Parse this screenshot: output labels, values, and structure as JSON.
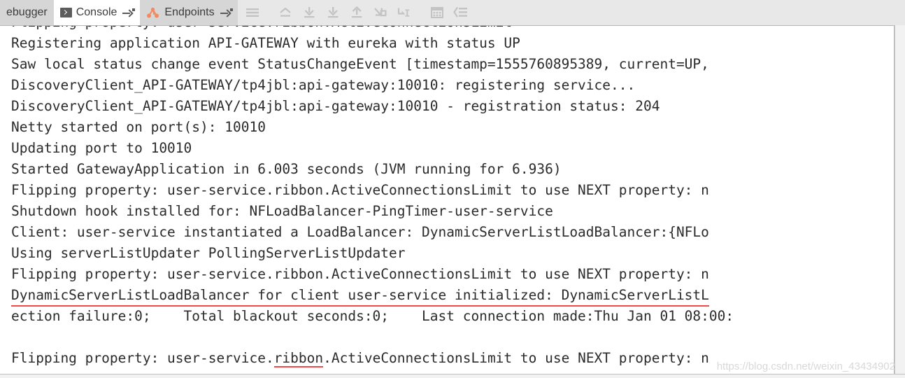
{
  "window": {
    "app": "IntelliJ IDEA Run/Debug Console"
  },
  "toolbar": {
    "tabs": [
      {
        "label": "ebugger",
        "icon": "",
        "state": "inactive",
        "truncated": true
      },
      {
        "label": "Console",
        "icon": "console-icon",
        "state": "active",
        "truncated": false
      },
      {
        "label": "Endpoints",
        "icon": "endpoints-graph-icon",
        "state": "inactive",
        "truncated": false
      }
    ],
    "buttons": [
      {
        "name": "menu-hamburger-icon",
        "title": "Menu"
      },
      {
        "name": "rerun-arrow-icon",
        "title": "Rerun"
      },
      {
        "name": "scroll-down-icon",
        "title": "Scroll to end"
      },
      {
        "name": "download-icon",
        "title": "Step down"
      },
      {
        "name": "upload-icon",
        "title": "Step up"
      },
      {
        "name": "jump-out-icon",
        "title": "Jump out"
      },
      {
        "name": "jump-to-cursor-icon",
        "title": "Run to cursor"
      },
      {
        "name": "grid-table-icon",
        "title": "Show as table"
      },
      {
        "name": "soft-wrap-icon",
        "title": "Soft-wrap"
      }
    ],
    "separators": 3
  },
  "console": {
    "font": "monospace",
    "text_color": "#2b2b2b",
    "underline_color": "#f04a4a",
    "lines": [
      {
        "text": "Flipping property: user-service.ribbon.ActiveConnectionsLimit",
        "clipped_top": true,
        "underline": "none"
      },
      {
        "text": "Registering application API-GATEWAY with eureka with status UP",
        "underline": "none"
      },
      {
        "text": "Saw local status change event StatusChangeEvent [timestamp=1555760895389, current=UP,",
        "underline": "none"
      },
      {
        "text": "DiscoveryClient_API-GATEWAY/tp4jbl:api-gateway:10010: registering service...",
        "underline": "none"
      },
      {
        "text": "DiscoveryClient_API-GATEWAY/tp4jbl:api-gateway:10010 - registration status: 204",
        "underline": "none"
      },
      {
        "text": "Netty started on port(s): 10010",
        "underline": "none"
      },
      {
        "text": "Updating port to 10010",
        "underline": "none"
      },
      {
        "text": "Started GatewayApplication in 6.003 seconds (JVM running for 6.936)",
        "underline": "none"
      },
      {
        "text": "Flipping property: user-service.ribbon.ActiveConnectionsLimit to use NEXT property: n",
        "underline": "none"
      },
      {
        "text": "Shutdown hook installed for: NFLoadBalancer-PingTimer-user-service",
        "underline": "none"
      },
      {
        "text": "Client: user-service instantiated a LoadBalancer: DynamicServerListLoadBalancer:{NFLo",
        "underline": "none"
      },
      {
        "text": "Using serverListUpdater PollingServerListUpdater",
        "underline": "none"
      },
      {
        "text": "Flipping property: user-service.ribbon.ActiveConnectionsLimit to use NEXT property: n",
        "underline": "none"
      },
      {
        "text": "DynamicServerListLoadBalancer for client user-service initialized: DynamicServerListL",
        "underline": "full"
      },
      {
        "text": "ection failure:0;    Total blackout seconds:0;    Last connection made:Thu Jan 01 08:00:",
        "underline": "none"
      },
      {
        "text": "",
        "underline": "none"
      },
      {
        "text": "Flipping property: user-service.ribbon.ActiveConnectionsLimit to use NEXT property: n",
        "underline": "word",
        "underline_word": "ribbon",
        "underline_prefix": "Flipping property: user-service.",
        "underline_suffix": ".ActiveConnectionsLimit to use NEXT property: n"
      }
    ]
  },
  "watermark": {
    "text": "https://blog.csdn.net/weixin_43434902"
  },
  "colors": {
    "toolbar_bg": "#e8e8e8",
    "tab_inactive_bg": "#d6d6d6",
    "tab_active_bg": "#ffffff",
    "console_bg": "#ffffff",
    "icon_gray": "#c3c3c3",
    "accent_orange": "#ef8a62",
    "underline_red": "#f04a4a"
  }
}
